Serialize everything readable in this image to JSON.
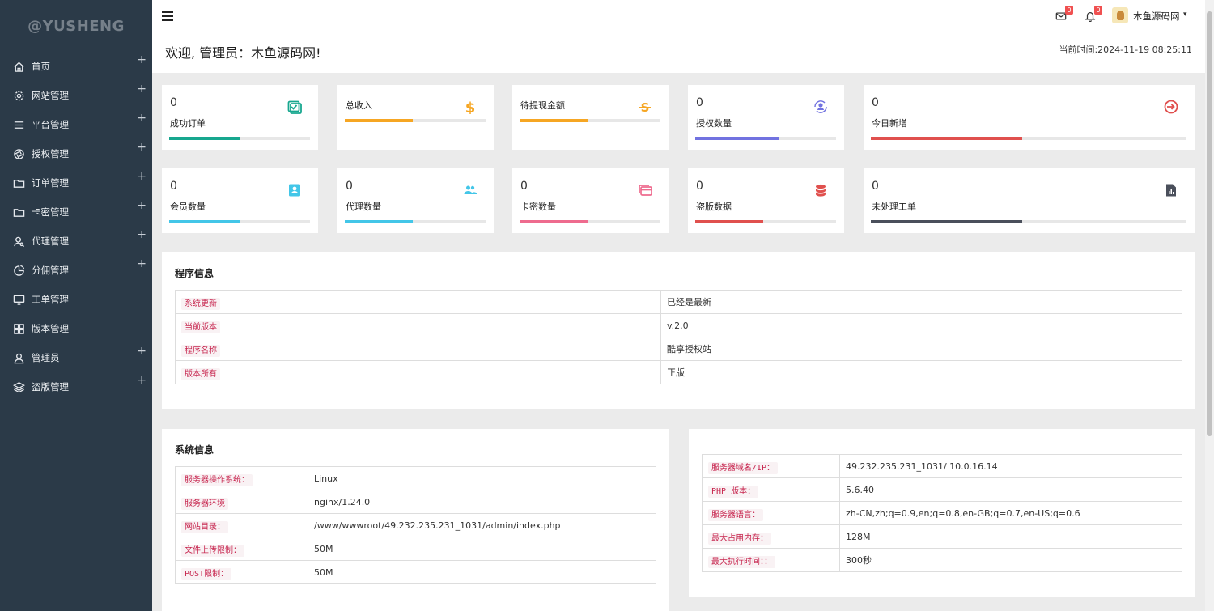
{
  "brand": "@YUSHENG",
  "sidebar": {
    "items": [
      {
        "label": "首页",
        "icon": "home-icon",
        "expandable": true
      },
      {
        "label": "网站管理",
        "icon": "gear-icon",
        "expandable": true
      },
      {
        "label": "平台管理",
        "icon": "menu-lines-icon",
        "expandable": true
      },
      {
        "label": "授权管理",
        "icon": "aperture-icon",
        "expandable": true
      },
      {
        "label": "订单管理",
        "icon": "folder-icon",
        "expandable": true
      },
      {
        "label": "卡密管理",
        "icon": "folder-icon",
        "expandable": true
      },
      {
        "label": "代理管理",
        "icon": "user-search-icon",
        "expandable": true
      },
      {
        "label": "分佣管理",
        "icon": "pie-icon",
        "expandable": true
      },
      {
        "label": "工单管理",
        "icon": "monitor-icon",
        "expandable": false
      },
      {
        "label": "版本管理",
        "icon": "grid-icon",
        "expandable": false
      },
      {
        "label": "管理员",
        "icon": "user-icon",
        "expandable": true
      },
      {
        "label": "盗版管理",
        "icon": "layers-icon",
        "expandable": true
      }
    ],
    "plus": "+"
  },
  "header": {
    "mail_badge": "0",
    "bell_badge": "0",
    "user_name": "木鱼源码网",
    "caret": "▾"
  },
  "welcome": "欢迎, 管理员：木鱼源码网!",
  "current_time": "当前时间:2024-11-19 08:25:11",
  "stats_row1": [
    {
      "value": "0",
      "label": "成功订单",
      "icon": "calendar-check-icon",
      "color": "#17a78f",
      "progress": 0.5
    },
    {
      "value": "",
      "label": "总收入",
      "icon": "dollar-icon",
      "color": "#f6a623",
      "progress": 0.48
    },
    {
      "value": "",
      "label": "待提现金额",
      "icon": "strikethrough-coin-icon",
      "color": "#f6a623",
      "progress": 0.48
    },
    {
      "value": "0",
      "label": "授权数量",
      "icon": "user-sync-icon",
      "color": "#7172e0",
      "progress": 0.6
    },
    {
      "value": "0",
      "label": "今日新增",
      "icon": "arrow-circle-icon",
      "color": "#e0504e",
      "progress": 0.48
    }
  ],
  "stats_row2": [
    {
      "value": "0",
      "label": "会员数量",
      "icon": "contact-card-icon",
      "color": "#43c6e8",
      "progress": 0.5
    },
    {
      "value": "0",
      "label": "代理数量",
      "icon": "group-icon",
      "color": "#43c6e8",
      "progress": 0.48
    },
    {
      "value": "0",
      "label": "卡密数量",
      "icon": "cards-icon",
      "color": "#ee6b8e",
      "progress": 0.48
    },
    {
      "value": "0",
      "label": "盗版数据",
      "icon": "database-icon",
      "color": "#e0504e",
      "progress": 0.48
    },
    {
      "value": "0",
      "label": "未处理工单",
      "icon": "report-icon",
      "color": "#4a4f5b",
      "progress": 0.48
    }
  ],
  "program_info": {
    "title": "程序信息",
    "rows": [
      {
        "key": "系统更新",
        "value": "已经是最新"
      },
      {
        "key": "当前版本",
        "value": "v.2.0"
      },
      {
        "key": "程序名称",
        "value": "酷享授权站"
      },
      {
        "key": "版本所有",
        "value": "正版"
      }
    ]
  },
  "system_info": {
    "title": "系统信息",
    "rows": [
      {
        "key": "服务器操作系统：",
        "value": "Linux"
      },
      {
        "key": "服务器环境",
        "value": "nginx/1.24.0"
      },
      {
        "key": "网站目录：",
        "value": "/www/wwwroot/49.232.235.231_1031/admin/index.php"
      },
      {
        "key": "文件上传限制：",
        "value": "50M"
      },
      {
        "key": "POST限制：",
        "value": "50M"
      }
    ]
  },
  "server_info": {
    "rows": [
      {
        "key": "服务器域名/IP：",
        "value": "49.232.235.231_1031/ 10.0.16.14"
      },
      {
        "key": "PHP 版本：",
        "value": "5.6.40"
      },
      {
        "key": "服务器语言：",
        "value": "zh-CN,zh;q=0.9,en;q=0.8,en-GB;q=0.7,en-US;q=0.6"
      },
      {
        "key": "最大占用内存：",
        "value": "128M"
      },
      {
        "key": "最大执行时间：：",
        "value": "300秒"
      }
    ]
  }
}
